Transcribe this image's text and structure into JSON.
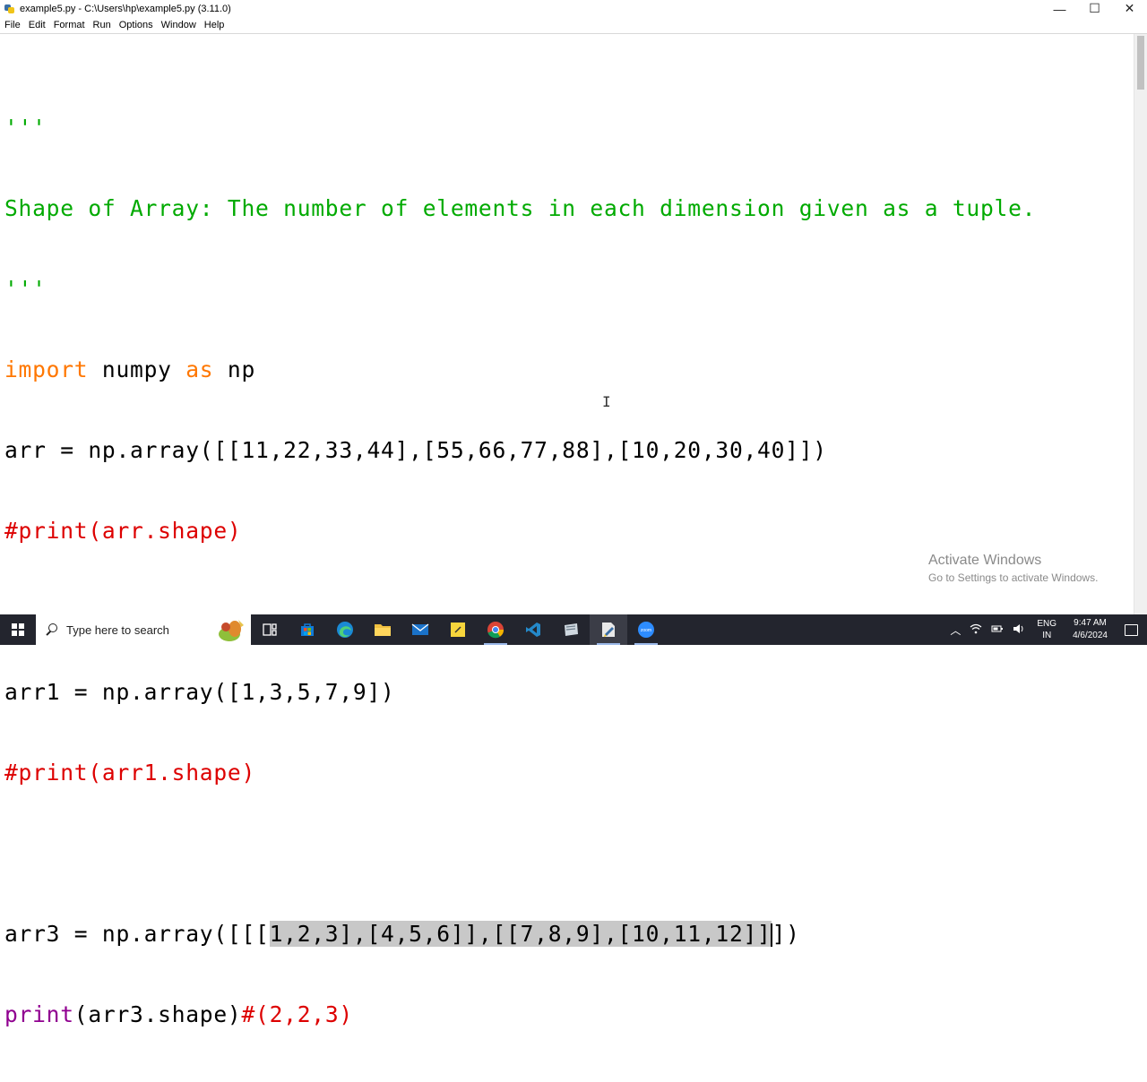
{
  "window": {
    "title": "example5.py - C:\\Users\\hp\\example5.py (3.11.0)",
    "controls": {
      "minimize": "—",
      "maximize": "☐",
      "close": "✕"
    }
  },
  "menu": [
    "File",
    "Edit",
    "Format",
    "Run",
    "Options",
    "Window",
    "Help"
  ],
  "code": {
    "l1": "'''",
    "l2": "Shape of Array: The number of elements in each dimension given as a tuple.",
    "l3": "'''",
    "l4_kw1": "import",
    "l4_mid": " numpy ",
    "l4_kw2": "as",
    "l4_end": " np",
    "l5": "arr = np.array([[11,22,33,44],[55,66,77,88],[10,20,30,40]])",
    "l6": "#print(arr.shape)",
    "l7": "",
    "l8": "arr1 = np.array([1,3,5,7,9])",
    "l9": "#print(arr1.shape)",
    "l10": "",
    "l11_pre": "arr3 = np.array([[[",
    "l11_sel": "1,2,3],[4,5,6]],[[7,8,9],[10,11,12]]",
    "l11_post": "])",
    "l12_bi": "print",
    "l12_mid": "(arr3.shape)",
    "l12_cmt": "#(2,2,3)"
  },
  "watermark": {
    "line1": "Activate Windows",
    "line2": "Go to Settings to activate Windows."
  },
  "taskbar": {
    "search_placeholder": "Type here to search",
    "lang_line1": "ENG",
    "lang_line2": "IN",
    "time": "9:47 AM",
    "date": "4/6/2024"
  }
}
